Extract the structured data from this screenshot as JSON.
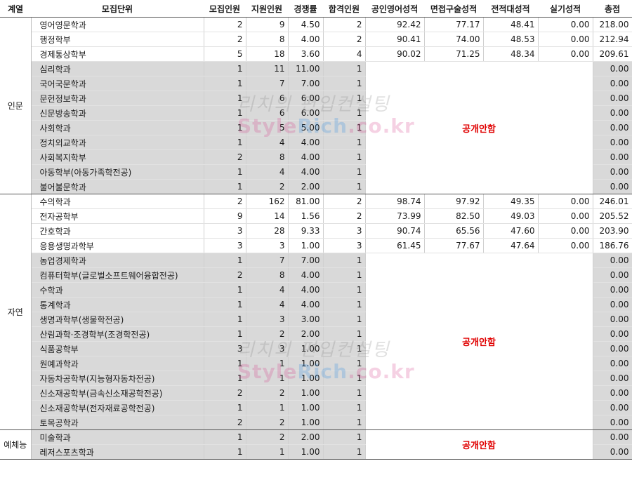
{
  "headers": [
    "계열",
    "모집단위",
    "모집인원",
    "지원인원",
    "경쟁률",
    "합격인원",
    "공인영어성적",
    "면접구술성적",
    "전적대성적",
    "실기성적",
    "총점"
  ],
  "hidden_label": "공개안함",
  "watermark": {
    "line1": "리치의 편입컨설팅",
    "line2_a": "Style",
    "line2_b": "Rich",
    "line2_c": ".co.kr"
  },
  "groups": [
    {
      "name": "인문",
      "rows": [
        {
          "unit": "영어영문학과",
          "recruit": "2",
          "apply": "9",
          "ratio": "4.50",
          "pass": "2",
          "english": "92.42",
          "interview": "77.17",
          "prev": "48.41",
          "practical": "0.00",
          "total": "218.00"
        },
        {
          "unit": "행정학부",
          "recruit": "2",
          "apply": "8",
          "ratio": "4.00",
          "pass": "2",
          "english": "90.41",
          "interview": "74.00",
          "prev": "48.53",
          "practical": "0.00",
          "total": "212.94"
        },
        {
          "unit": "경제통상학부",
          "recruit": "5",
          "apply": "18",
          "ratio": "3.60",
          "pass": "4",
          "english": "90.02",
          "interview": "71.25",
          "prev": "48.34",
          "practical": "0.00",
          "total": "209.61"
        },
        {
          "unit": "심리학과",
          "recruit": "1",
          "apply": "11",
          "ratio": "11.00",
          "pass": "1",
          "total": "0.00"
        },
        {
          "unit": "국어국문학과",
          "recruit": "1",
          "apply": "7",
          "ratio": "7.00",
          "pass": "1",
          "total": "0.00"
        },
        {
          "unit": "문헌정보학과",
          "recruit": "1",
          "apply": "6",
          "ratio": "6.00",
          "pass": "1",
          "total": "0.00"
        },
        {
          "unit": "신문방송학과",
          "recruit": "1",
          "apply": "6",
          "ratio": "6.00",
          "pass": "1",
          "total": "0.00"
        },
        {
          "unit": "사회학과",
          "recruit": "1",
          "apply": "5",
          "ratio": "5.00",
          "pass": "1",
          "total": "0.00"
        },
        {
          "unit": "정치외교학과",
          "recruit": "1",
          "apply": "4",
          "ratio": "4.00",
          "pass": "1",
          "total": "0.00"
        },
        {
          "unit": "사회복지학부",
          "recruit": "2",
          "apply": "8",
          "ratio": "4.00",
          "pass": "1",
          "total": "0.00"
        },
        {
          "unit": "아동학부(아동가족학전공)",
          "recruit": "1",
          "apply": "4",
          "ratio": "4.00",
          "pass": "1",
          "total": "0.00"
        },
        {
          "unit": "불어불문학과",
          "recruit": "1",
          "apply": "2",
          "ratio": "2.00",
          "pass": "1",
          "total": "0.00"
        }
      ]
    },
    {
      "name": "자연",
      "rows": [
        {
          "unit": "수의학과",
          "recruit": "2",
          "apply": "162",
          "ratio": "81.00",
          "pass": "2",
          "english": "98.74",
          "interview": "97.92",
          "prev": "49.35",
          "practical": "0.00",
          "total": "246.01"
        },
        {
          "unit": "전자공학부",
          "recruit": "9",
          "apply": "14",
          "ratio": "1.56",
          "pass": "2",
          "english": "73.99",
          "interview": "82.50",
          "prev": "49.03",
          "practical": "0.00",
          "total": "205.52"
        },
        {
          "unit": "간호학과",
          "recruit": "3",
          "apply": "28",
          "ratio": "9.33",
          "pass": "3",
          "english": "90.74",
          "interview": "65.56",
          "prev": "47.60",
          "practical": "0.00",
          "total": "203.90"
        },
        {
          "unit": "응용생명과학부",
          "recruit": "3",
          "apply": "3",
          "ratio": "1.00",
          "pass": "3",
          "english": "61.45",
          "interview": "77.67",
          "prev": "47.64",
          "practical": "0.00",
          "total": "186.76"
        },
        {
          "unit": "농업경제학과",
          "recruit": "1",
          "apply": "7",
          "ratio": "7.00",
          "pass": "1",
          "total": "0.00"
        },
        {
          "unit": "컴퓨터학부(글로벌소프트웨어융합전공)",
          "recruit": "2",
          "apply": "8",
          "ratio": "4.00",
          "pass": "1",
          "total": "0.00"
        },
        {
          "unit": "수학과",
          "recruit": "1",
          "apply": "4",
          "ratio": "4.00",
          "pass": "1",
          "total": "0.00"
        },
        {
          "unit": "통계학과",
          "recruit": "1",
          "apply": "4",
          "ratio": "4.00",
          "pass": "1",
          "total": "0.00"
        },
        {
          "unit": "생명과학부(생물학전공)",
          "recruit": "1",
          "apply": "3",
          "ratio": "3.00",
          "pass": "1",
          "total": "0.00"
        },
        {
          "unit": "산림과학·조경학부(조경학전공)",
          "recruit": "1",
          "apply": "2",
          "ratio": "2.00",
          "pass": "1",
          "total": "0.00"
        },
        {
          "unit": "식품공학부",
          "recruit": "3",
          "apply": "3",
          "ratio": "1.00",
          "pass": "1",
          "total": "0.00"
        },
        {
          "unit": "원예과학과",
          "recruit": "1",
          "apply": "1",
          "ratio": "1.00",
          "pass": "1",
          "total": "0.00"
        },
        {
          "unit": "자동차공학부(지능형자동차전공)",
          "recruit": "1",
          "apply": "1",
          "ratio": "1.00",
          "pass": "1",
          "total": "0.00"
        },
        {
          "unit": "신소재공학부(금속신소재공학전공)",
          "recruit": "2",
          "apply": "2",
          "ratio": "1.00",
          "pass": "1",
          "total": "0.00"
        },
        {
          "unit": "신소재공학부(전자재료공학전공)",
          "recruit": "1",
          "apply": "1",
          "ratio": "1.00",
          "pass": "1",
          "total": "0.00"
        },
        {
          "unit": "토목공학과",
          "recruit": "2",
          "apply": "2",
          "ratio": "1.00",
          "pass": "1",
          "total": "0.00"
        }
      ]
    },
    {
      "name": "예체능",
      "rows": [
        {
          "unit": "미술학과",
          "recruit": "1",
          "apply": "2",
          "ratio": "2.00",
          "pass": "1",
          "total": "0.00"
        },
        {
          "unit": "레저스포츠학과",
          "recruit": "1",
          "apply": "1",
          "ratio": "1.00",
          "pass": "1",
          "total": "0.00"
        }
      ]
    }
  ]
}
